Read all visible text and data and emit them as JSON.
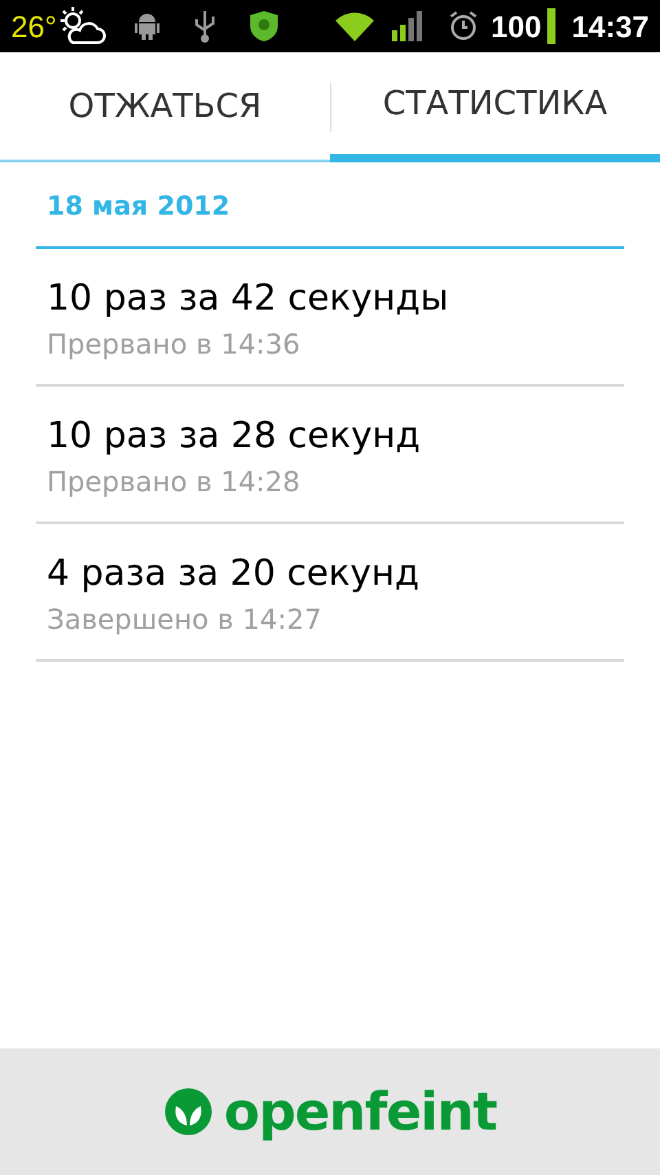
{
  "status_bar": {
    "temperature": "26°",
    "battery": "100",
    "time": "14:37"
  },
  "tabs": [
    {
      "label": "ОТЖАТЬСЯ",
      "selected": false
    },
    {
      "label": "СТАТИСТИКА",
      "selected": true
    }
  ],
  "sections": [
    {
      "date": "18 мая 2012",
      "entries": [
        {
          "title": "10 раз за 42 секунды",
          "status": "Прервано в 14:36"
        },
        {
          "title": "10 раз за 28 секунд",
          "status": "Прервано в 14:28"
        },
        {
          "title": "4 раза за 20 секунд",
          "status": "Завершено в 14:27"
        }
      ]
    }
  ],
  "ad_banner": {
    "brand": "openfeint"
  }
}
